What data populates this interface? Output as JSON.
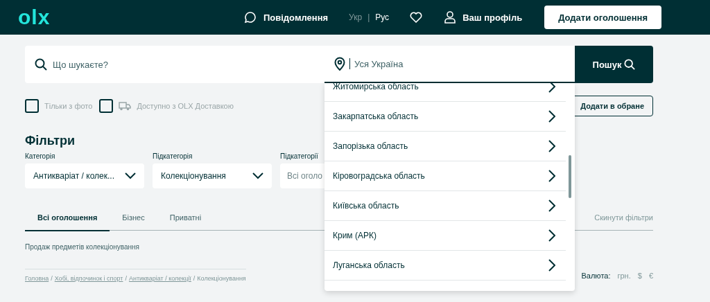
{
  "header": {
    "logo": "olx",
    "messages": "Повідомлення",
    "language_separator": "|",
    "languages": [
      {
        "label": "Укр",
        "selected": true
      },
      {
        "label": "Рус",
        "selected": false
      }
    ],
    "profile": "Ваш профіль",
    "post_button": "Додати оголошення"
  },
  "search": {
    "placeholder": "Що шукаєте?",
    "location_placeholder": "Уся Україна",
    "button": "Пошук"
  },
  "options": [
    {
      "label": "Тільки з фото",
      "checked": false,
      "kind": "plain"
    },
    {
      "label": "Доступно з OLX Доставкою",
      "checked": false,
      "kind": "delivery"
    }
  ],
  "favorite_button": "Додати в обране",
  "filters": {
    "title": "Фільтри",
    "selects": [
      {
        "label": "Категорія",
        "value": "Антикваріат / колек..."
      },
      {
        "label": "Підкатегорія",
        "value": "Колекціонування"
      },
      {
        "label": "Підкатегорії",
        "placeholder": "Всі оголо"
      }
    ]
  },
  "tabs": [
    {
      "label": "Всі оголошення",
      "selected": true
    },
    {
      "label": "Бізнес",
      "selected": false
    },
    {
      "label": "Приватні",
      "selected": false
    }
  ],
  "reset_filters": "Скинути фільтри",
  "description": "Продаж предметів колекціонування",
  "breadcrumb_separator": "/",
  "breadcrumbs": [
    {
      "label": "Головна",
      "link": true
    },
    {
      "label": "Хобі, відпочинок і спорт",
      "link": true
    },
    {
      "label": "Антикваріат / колекції",
      "link": true
    },
    {
      "label": "Колекціонування",
      "link": false
    }
  ],
  "currency": {
    "label": "Валюта:",
    "options": [
      {
        "label": "грн."
      },
      {
        "label": "$"
      },
      {
        "label": "€"
      }
    ]
  },
  "region_dropdown": {
    "items": [
      "Житомирська область",
      "Закарпатська область",
      "Запорізька область",
      "Кіровоградська область",
      "Київська область",
      "Крим (АРК)",
      "Луганська область"
    ]
  }
}
